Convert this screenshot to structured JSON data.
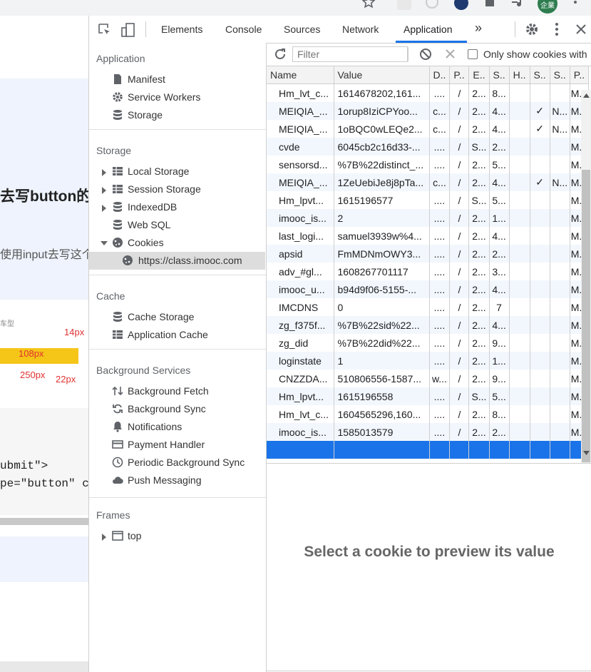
{
  "tabs": [
    "Elements",
    "Console",
    "Sources",
    "Network",
    "Application"
  ],
  "more_tabs": "»",
  "page_text": {
    "heading_fragment": "去写button的",
    "para_fragment": "使用input去写这个",
    "fig_top": "车型",
    "fig_14px": "14px",
    "fig_108px": "108px",
    "fig_250px": "250px",
    "fig_22px": "22px",
    "code1": "ubmit\">",
    "code2": "pe=\"button\" c"
  },
  "sidebar": {
    "application_title": "Application",
    "application_items": [
      "Manifest",
      "Service Workers",
      "Storage"
    ],
    "storage_title": "Storage",
    "storage_items": [
      "Local Storage",
      "Session Storage",
      "IndexedDB",
      "Web SQL",
      "Cookies"
    ],
    "cookie_origin": "https://class.imooc.com",
    "cache_title": "Cache",
    "cache_items": [
      "Cache Storage",
      "Application Cache"
    ],
    "bg_title": "Background Services",
    "bg_items": [
      "Background Fetch",
      "Background Sync",
      "Notifications",
      "Payment Handler",
      "Periodic Background Sync",
      "Push Messaging"
    ],
    "frames_title": "Frames",
    "frames_items": [
      "top"
    ]
  },
  "filter": {
    "placeholder": "Filter",
    "only_issues_label": "Only show cookies with"
  },
  "table": {
    "headers": [
      "Name",
      "Value",
      "D..",
      "P..",
      "E..",
      "S..",
      "H..",
      "S..",
      "S..",
      "P.."
    ],
    "rows": [
      [
        "Hm_lvt_c...",
        "1614678202,161...",
        "....",
        "/",
        "2...",
        "8...",
        "",
        "",
        "",
        "M..."
      ],
      [
        "MEIQIA_...",
        "1orup8IziCPYoo...",
        "c...",
        "/",
        "2...",
        "4...",
        "",
        "✓",
        "N...",
        "M..."
      ],
      [
        "MEIQIA_...",
        "1oBQC0wLEQe2...",
        "c...",
        "/",
        "2...",
        "4...",
        "",
        "✓",
        "N...",
        "M..."
      ],
      [
        "cvde",
        "6045cb2c16d33-...",
        "....",
        "/",
        "S...",
        "2...",
        "",
        "",
        "",
        "M..."
      ],
      [
        "sensorsd...",
        "%7B%22distinct_...",
        "....",
        "/",
        "2...",
        "5...",
        "",
        "",
        "",
        "M..."
      ],
      [
        "MEIQIA_...",
        "1ZeUebiJe8j8pTa...",
        "c...",
        "/",
        "2...",
        "4...",
        "",
        "✓",
        "N...",
        "M..."
      ],
      [
        "Hm_lpvt...",
        "1615196577",
        "....",
        "/",
        "S...",
        "5...",
        "",
        "",
        "",
        "M..."
      ],
      [
        "imooc_is...",
        "2",
        "....",
        "/",
        "2...",
        "1...",
        "",
        "",
        "",
        "M..."
      ],
      [
        "last_logi...",
        "samuel3939w%4...",
        "....",
        "/",
        "2...",
        "4...",
        "",
        "",
        "",
        "M..."
      ],
      [
        "apsid",
        "FmMDNmOWY3...",
        "....",
        "/",
        "2...",
        "2...",
        "",
        "",
        "",
        "M..."
      ],
      [
        "adv_#gl...",
        "1608267701117",
        "....",
        "/",
        "2...",
        "3...",
        "",
        "",
        "",
        "M..."
      ],
      [
        "imooc_u...",
        "b94d9f06-5155-...",
        "....",
        "/",
        "2...",
        "4...",
        "",
        "",
        "",
        "M..."
      ],
      [
        "IMCDNS",
        "0",
        "....",
        "/",
        "2...",
        "7",
        "",
        "",
        "",
        "M..."
      ],
      [
        "zg_f375f...",
        "%7B%22sid%22...",
        "....",
        "/",
        "2...",
        "4...",
        "",
        "",
        "",
        "M..."
      ],
      [
        "zg_did",
        "%7B%22did%22...",
        "....",
        "/",
        "2...",
        "9...",
        "",
        "",
        "",
        "M..."
      ],
      [
        "loginstate",
        "1",
        "....",
        "/",
        "2...",
        "1...",
        "",
        "",
        "",
        "M..."
      ],
      [
        "CNZZDA...",
        "510806556-1587...",
        "w...",
        "/",
        "2...",
        "9...",
        "",
        "",
        "",
        "M..."
      ],
      [
        "Hm_lpvt...",
        "1615196558",
        "....",
        "/",
        "S...",
        "5...",
        "",
        "",
        "",
        "M..."
      ],
      [
        "Hm_lvt_c...",
        "1604565296,160...",
        "....",
        "/",
        "2...",
        "8...",
        "",
        "",
        "",
        "M..."
      ],
      [
        "imooc_is...",
        "1585013579",
        "....",
        "/",
        "2...",
        "2...",
        "",
        "",
        "",
        "M..."
      ]
    ]
  },
  "preview_message": "Select a cookie to preview its value",
  "avatar_text": "企業",
  "colors": {
    "accent": "#1a73e8",
    "row_alt": "#f2f7fd"
  }
}
